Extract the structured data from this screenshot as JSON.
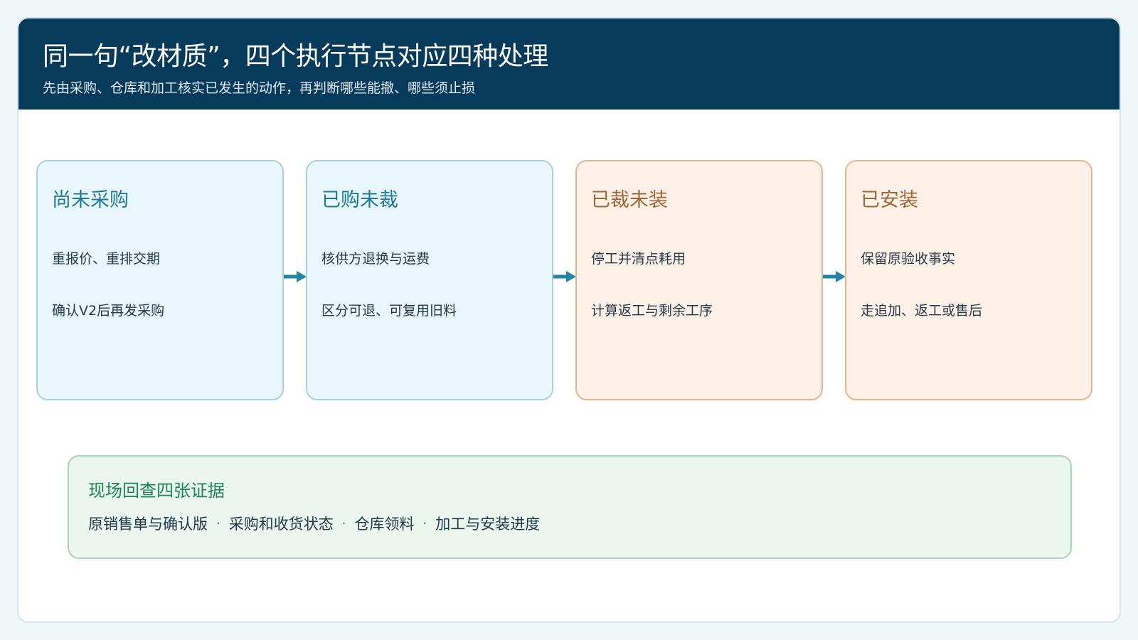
{
  "header": {
    "title": "同一句“改材质”，四个执行节点对应四种处理",
    "subtitle": "先由采购、仓库和加工核实已发生的动作，再判断哪些能撤、哪些须止损"
  },
  "stages": [
    {
      "title": "尚未采购",
      "items": [
        "重报价、重排交期",
        "确认V2后再发采购"
      ],
      "tone": "blue"
    },
    {
      "title": "已购未裁",
      "items": [
        "核供方退换与运费",
        "区分可退、可复用旧料"
      ],
      "tone": "blue"
    },
    {
      "title": "已裁未装",
      "items": [
        "停工并清点耗用",
        "计算返工与剩余工序"
      ],
      "tone": "orange"
    },
    {
      "title": "已安装",
      "items": [
        "保留原验收事实",
        "走追加、返工或售后"
      ],
      "tone": "orange"
    }
  ],
  "evidence": {
    "title": "现场回查四张证据",
    "items": [
      "原销售单与确认版",
      "采购和收货状态",
      "仓库领料",
      "加工与安装进度"
    ],
    "separator": "·"
  },
  "colors": {
    "header_bg": "#073b5c",
    "blue_fill": "#e9f6fb",
    "blue_border": "#a6d2dc",
    "orange_fill": "#fff1e8",
    "orange_border": "#e8b58b",
    "green_fill": "#ebf6ee",
    "green_border": "#a9d3b6",
    "arrow": "#1f86a6"
  },
  "icons": {
    "arrow": "arrow-right-icon"
  }
}
